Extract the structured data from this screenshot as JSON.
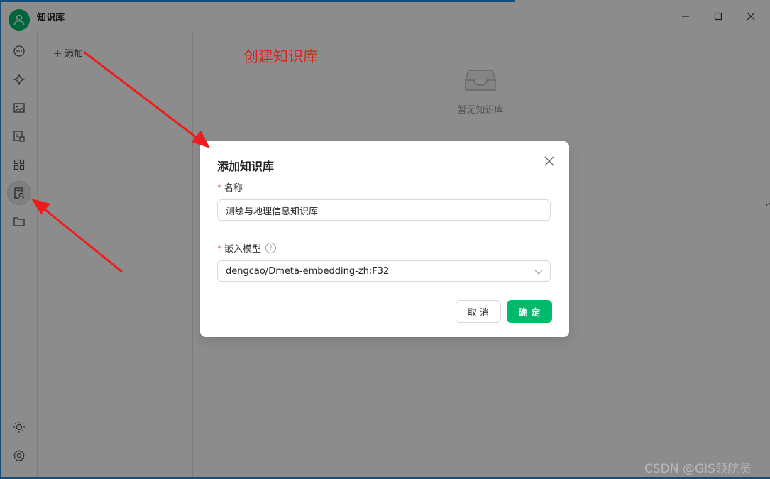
{
  "app": {
    "title": "知识库",
    "add_label": "添加",
    "empty_text": "暂无知识库"
  },
  "annotation": {
    "title": "创建知识库"
  },
  "sidebar": {
    "items": [
      {
        "name": "chat-icon"
      },
      {
        "name": "sparkle-icon"
      },
      {
        "name": "image-icon"
      },
      {
        "name": "translate-icon"
      },
      {
        "name": "apps-grid-icon"
      },
      {
        "name": "knowledge-icon",
        "active": true
      },
      {
        "name": "folder-icon"
      }
    ],
    "bottom_items": [
      {
        "name": "theme-sun-icon"
      },
      {
        "name": "settings-gear-icon"
      }
    ]
  },
  "modal": {
    "title": "添加知识库",
    "name_label": "名称",
    "name_value": "测绘与地理信息知识库",
    "model_label": "嵌入模型",
    "model_value": "dengcao/Dmeta-embedding-zh:F32",
    "cancel_label": "取 消",
    "ok_label": "确 定",
    "required_mark": "*",
    "help_mark": "?"
  },
  "colors": {
    "accent": "#00b96b",
    "annotation_red": "#e0241d",
    "frame_blue": "#2b8ad8"
  },
  "watermark": "CSDN @GIS领航员"
}
